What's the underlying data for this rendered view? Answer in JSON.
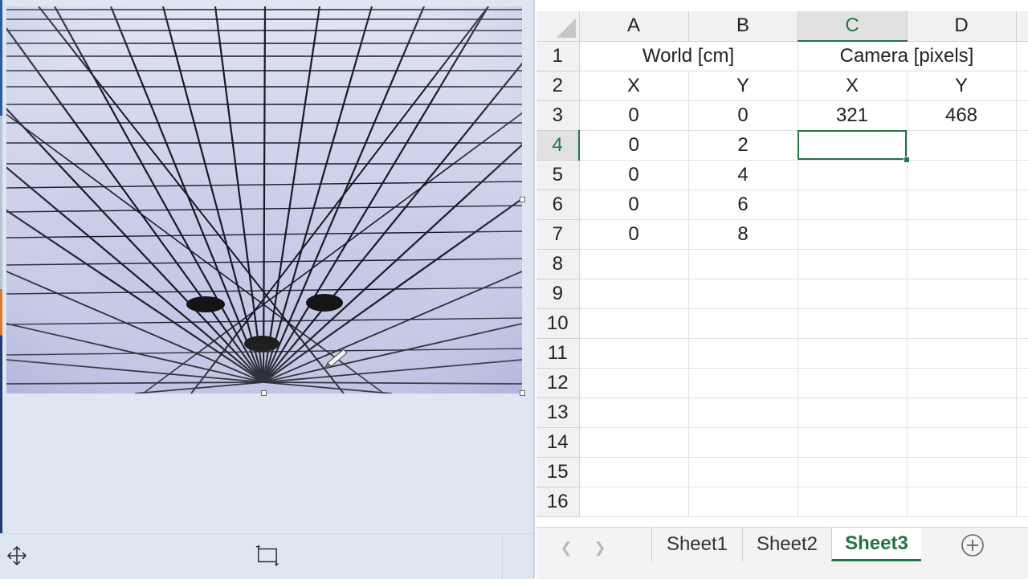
{
  "viewer": {
    "tools": [
      {
        "name": "move",
        "icon": "move-arrows-icon"
      },
      {
        "name": "crop",
        "icon": "crop-icon"
      }
    ]
  },
  "sheet": {
    "columns": [
      "A",
      "B",
      "C",
      "D"
    ],
    "rows": [
      "1",
      "2",
      "3",
      "4",
      "5",
      "6",
      "7",
      "8",
      "9",
      "10",
      "11",
      "12",
      "13",
      "14",
      "15",
      "16"
    ],
    "selected_cell": "C4",
    "header1": {
      "world": "World [cm]",
      "camera": "Camera [pixels]"
    },
    "header2": [
      "X",
      "Y",
      "X",
      "Y"
    ],
    "data": [
      [
        "0",
        "0",
        "321",
        "468"
      ],
      [
        "0",
        "2",
        "",
        ""
      ],
      [
        "0",
        "4",
        "",
        ""
      ],
      [
        "0",
        "6",
        "",
        ""
      ],
      [
        "0",
        "8",
        "",
        ""
      ]
    ],
    "tabs": [
      "Sheet1",
      "Sheet2",
      "Sheet3"
    ],
    "active_tab": "Sheet3",
    "accent": "#217346"
  }
}
